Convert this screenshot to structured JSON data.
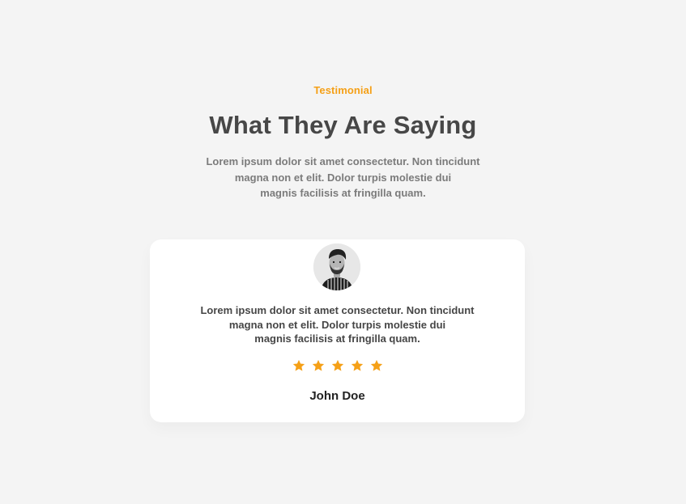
{
  "section": {
    "eyebrow": "Testimonial",
    "heading": "What They Are Saying",
    "intro_lines": [
      "Lorem ipsum dolor sit amet consectetur. Non tincidunt",
      "magna non et elit. Dolor  turpis molestie dui",
      "magnis facilisis at fringilla quam."
    ]
  },
  "testimonial": {
    "avatar": "person-avatar",
    "quote_lines": [
      "Lorem ipsum dolor sit amet consectetur. Non tincidunt",
      "magna non et elit. Dolor  turpis molestie dui",
      "magnis facilisis at fringilla quam."
    ],
    "rating": 5,
    "rating_max": 5,
    "star_icon": "star-icon",
    "name": "John Doe"
  },
  "colors": {
    "background": "#f4f4f4",
    "accent": "#f5a017",
    "heading": "#474747",
    "body_text": "#7b7b7b",
    "card": "#ffffff"
  }
}
